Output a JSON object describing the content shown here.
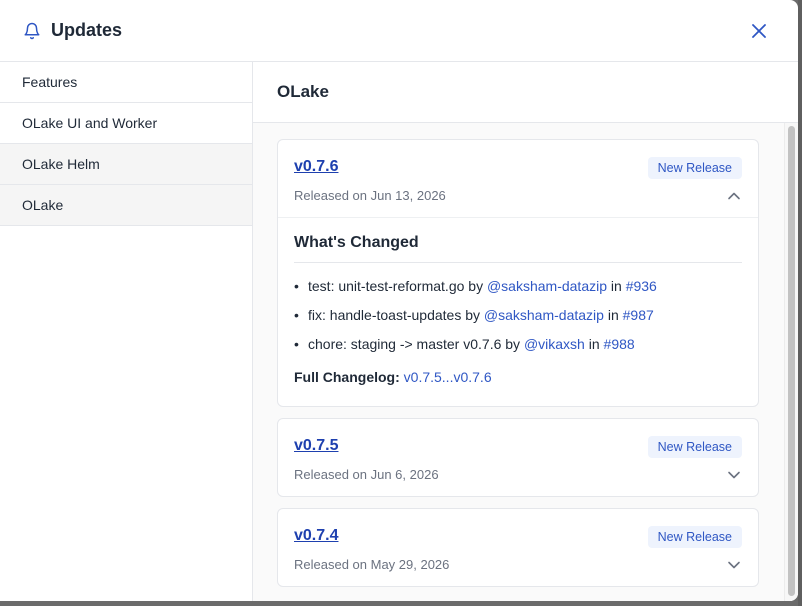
{
  "header": {
    "title": "Updates",
    "icon": "bell-icon",
    "close_icon": "close-icon"
  },
  "sidebar": {
    "items": [
      {
        "label": "Features"
      },
      {
        "label": "OLake UI and Worker"
      },
      {
        "label": "OLake Helm"
      },
      {
        "label": "OLake"
      }
    ]
  },
  "main": {
    "title": "OLake"
  },
  "releases": [
    {
      "version": "v0.7.6",
      "badge": "New Release",
      "date": "Released on Jun 13, 2026",
      "expanded": true,
      "heading": "What's Changed",
      "changes": [
        {
          "text": "test: unit-test-reformat.go by",
          "user": "@saksham-datazip",
          "in": "in",
          "pr": "#936"
        },
        {
          "text": "fix: handle-toast-updates by",
          "user": "@saksham-datazip",
          "in": "in",
          "pr": "#987"
        },
        {
          "text": "chore: staging -> master v0.7.6 by",
          "user": "@vikaxsh",
          "in": "in",
          "pr": "#988"
        }
      ],
      "full_changelog_label": "Full Changelog:",
      "full_changelog_link": "v0.7.5...v0.7.6"
    },
    {
      "version": "v0.7.5",
      "badge": "New Release",
      "date": "Released on Jun 6, 2026",
      "expanded": false
    },
    {
      "version": "v0.7.4",
      "badge": "New Release",
      "date": "Released on May 29, 2026",
      "expanded": false
    }
  ],
  "colors": {
    "link": "#2f57c4",
    "version_link": "#1e40af",
    "badge_bg": "#eef3fd",
    "close_icon": "#2f57c4"
  }
}
